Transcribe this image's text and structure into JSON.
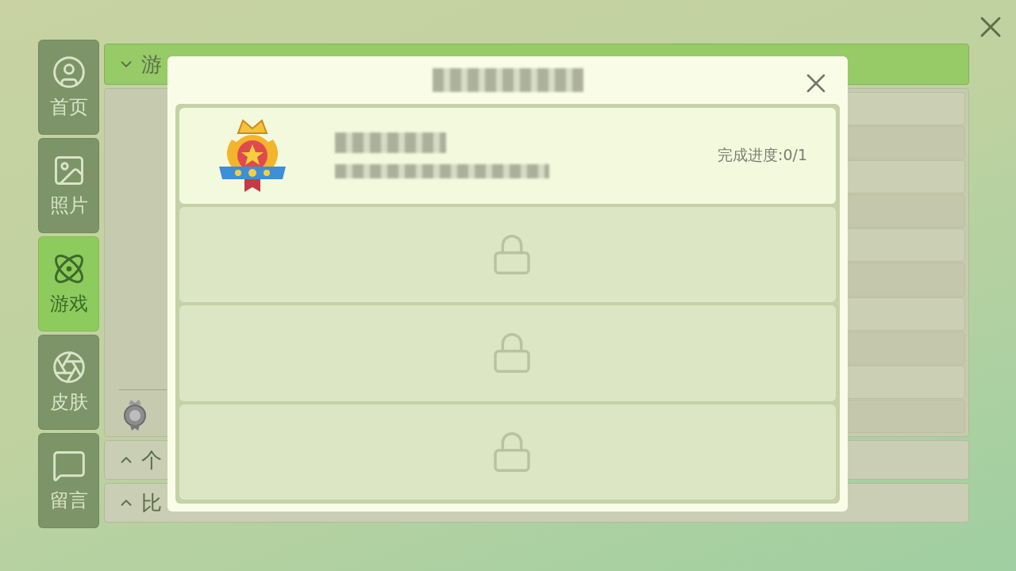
{
  "sidebar": {
    "items": [
      {
        "label": "首页",
        "selected": false
      },
      {
        "label": "照片",
        "selected": false
      },
      {
        "label": "游戏",
        "selected": true
      },
      {
        "label": "皮肤",
        "selected": false
      },
      {
        "label": "留言",
        "selected": false
      }
    ]
  },
  "sections": [
    {
      "title": "游",
      "expanded": true
    },
    {
      "title": "个",
      "expanded": false
    },
    {
      "title": "比",
      "expanded": false
    }
  ],
  "dialog": {
    "tasks": [
      {
        "kind": "unlocked",
        "progress": "完成进度:0/1"
      },
      {
        "kind": "locked"
      },
      {
        "kind": "locked"
      },
      {
        "kind": "locked"
      }
    ]
  }
}
